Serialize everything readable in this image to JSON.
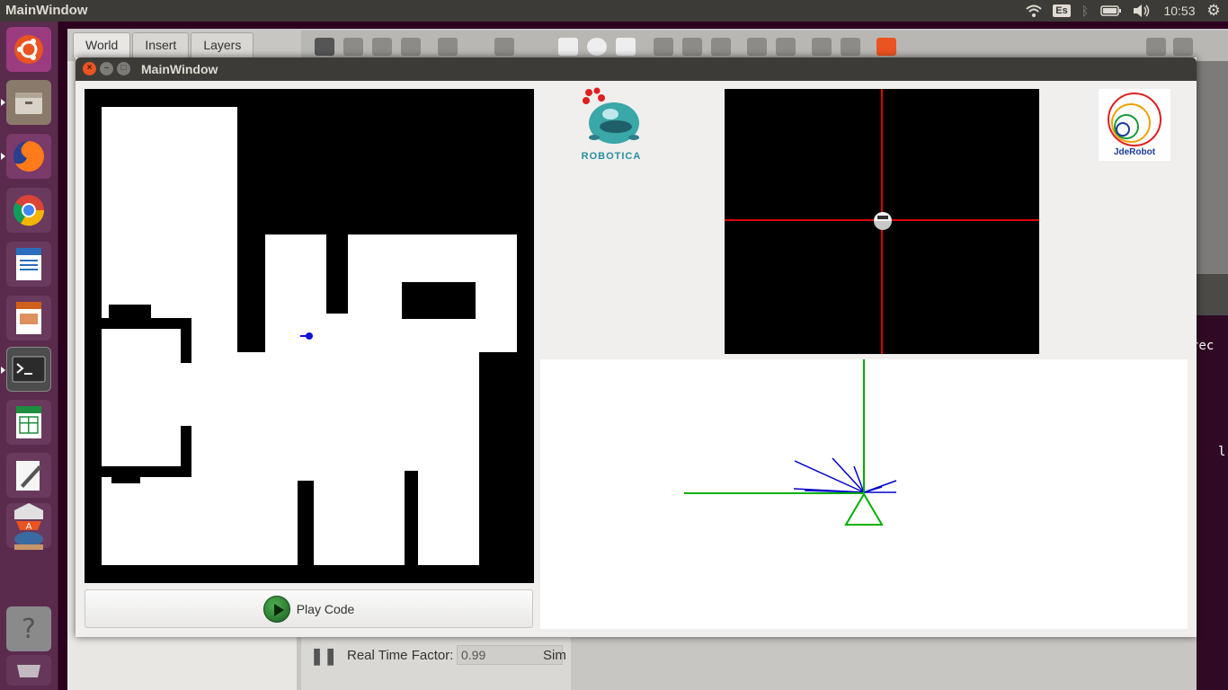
{
  "top_panel": {
    "app_title": "MainWindow",
    "keyboard_layout": "Es",
    "clock": "10:53"
  },
  "launcher": {
    "items": [
      {
        "name": "ubuntu-dash-icon"
      },
      {
        "name": "files-icon"
      },
      {
        "name": "firefox-icon"
      },
      {
        "name": "chrome-icon"
      },
      {
        "name": "writer-icon"
      },
      {
        "name": "impress-icon"
      },
      {
        "name": "terminal-icon"
      },
      {
        "name": "calc-icon"
      },
      {
        "name": "text-editor-icon"
      },
      {
        "name": "software-center-icon"
      },
      {
        "name": "help-icon"
      }
    ]
  },
  "gazebo": {
    "tabs": [
      {
        "label": "World",
        "active": true
      },
      {
        "label": "Insert",
        "active": false
      },
      {
        "label": "Layers",
        "active": false
      }
    ],
    "bottom": {
      "real_time_factor_label": "Real Time Factor:",
      "real_time_factor_value": "0.99",
      "sim_label": "Sim"
    }
  },
  "terminal": {
    "lines": [
      "rec",
      "l"
    ]
  },
  "main_window": {
    "title": "MainWindow",
    "play_button_label": "Play Code",
    "robotica_logo_text": "ROBOTICA",
    "jderobot_logo_text": "JdeRobot"
  },
  "colors": {
    "ubuntu_orange": "#e95420",
    "panel_dark": "#3c3b37",
    "launcher_purple": "#5a2b4d",
    "laser_blue": "#0000cc",
    "laser_green": "#00b000",
    "crosshair_red": "#e00000"
  }
}
